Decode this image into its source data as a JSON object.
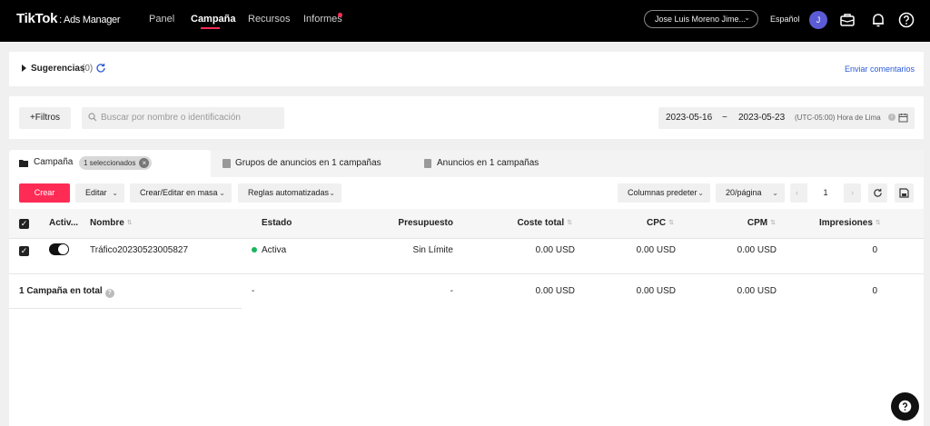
{
  "header": {
    "logo": "TikTok",
    "logo_sub": ": Ads Manager",
    "nav": [
      {
        "label": "Panel"
      },
      {
        "label": "Campaña"
      },
      {
        "label": "Recursos"
      },
      {
        "label": "Informes"
      }
    ],
    "account": "Jose Luis Moreno Jime...",
    "language": "Español",
    "avatar_letter": "J"
  },
  "suggestions": {
    "label": "Sugerencias",
    "count": "(0)",
    "feedback": "Enviar comentarios"
  },
  "filters": {
    "filter_button": "+Filtros",
    "search_placeholder": "Buscar por nombre o identificación",
    "date_start": "2023-05-16",
    "date_sep": "~",
    "date_end": "2023-05-23",
    "timezone": "(UTC-05:00) Hora de Lima"
  },
  "tabs": {
    "campaign": "Campaña",
    "selected_badge": "1 seleccionados",
    "adgroups": "Grupos de anuncios en 1 campañas",
    "ads": "Anuncios en 1 campañas"
  },
  "toolbar": {
    "create": "Crear",
    "edit": "Editar",
    "bulk": "Crear/Editar en masa",
    "rules": "Reglas automatizadas",
    "columns": "Columnas predeter",
    "per_page": "20/página",
    "page": "1"
  },
  "table": {
    "headers": [
      "Activ...",
      "Nombre",
      "Estado",
      "Presupuesto",
      "Coste total",
      "CPC",
      "CPM",
      "Impresiones"
    ],
    "rows": [
      {
        "name": "Tráfico20230523005827",
        "status": "Activa",
        "budget": "Sin Límite",
        "cost": "0.00 USD",
        "cpc": "0.00 USD",
        "cpm": "0.00 USD",
        "impressions": "0"
      }
    ],
    "total": {
      "label": "1 Campaña en total",
      "status": "-",
      "budget": "-",
      "cost": "0.00 USD",
      "cpc": "0.00 USD",
      "cpm": "0.00 USD",
      "impressions": "0"
    }
  },
  "colors": {
    "accent": "#fe2c55",
    "active_status": "#1bb55c",
    "link": "#2c5bd8"
  }
}
